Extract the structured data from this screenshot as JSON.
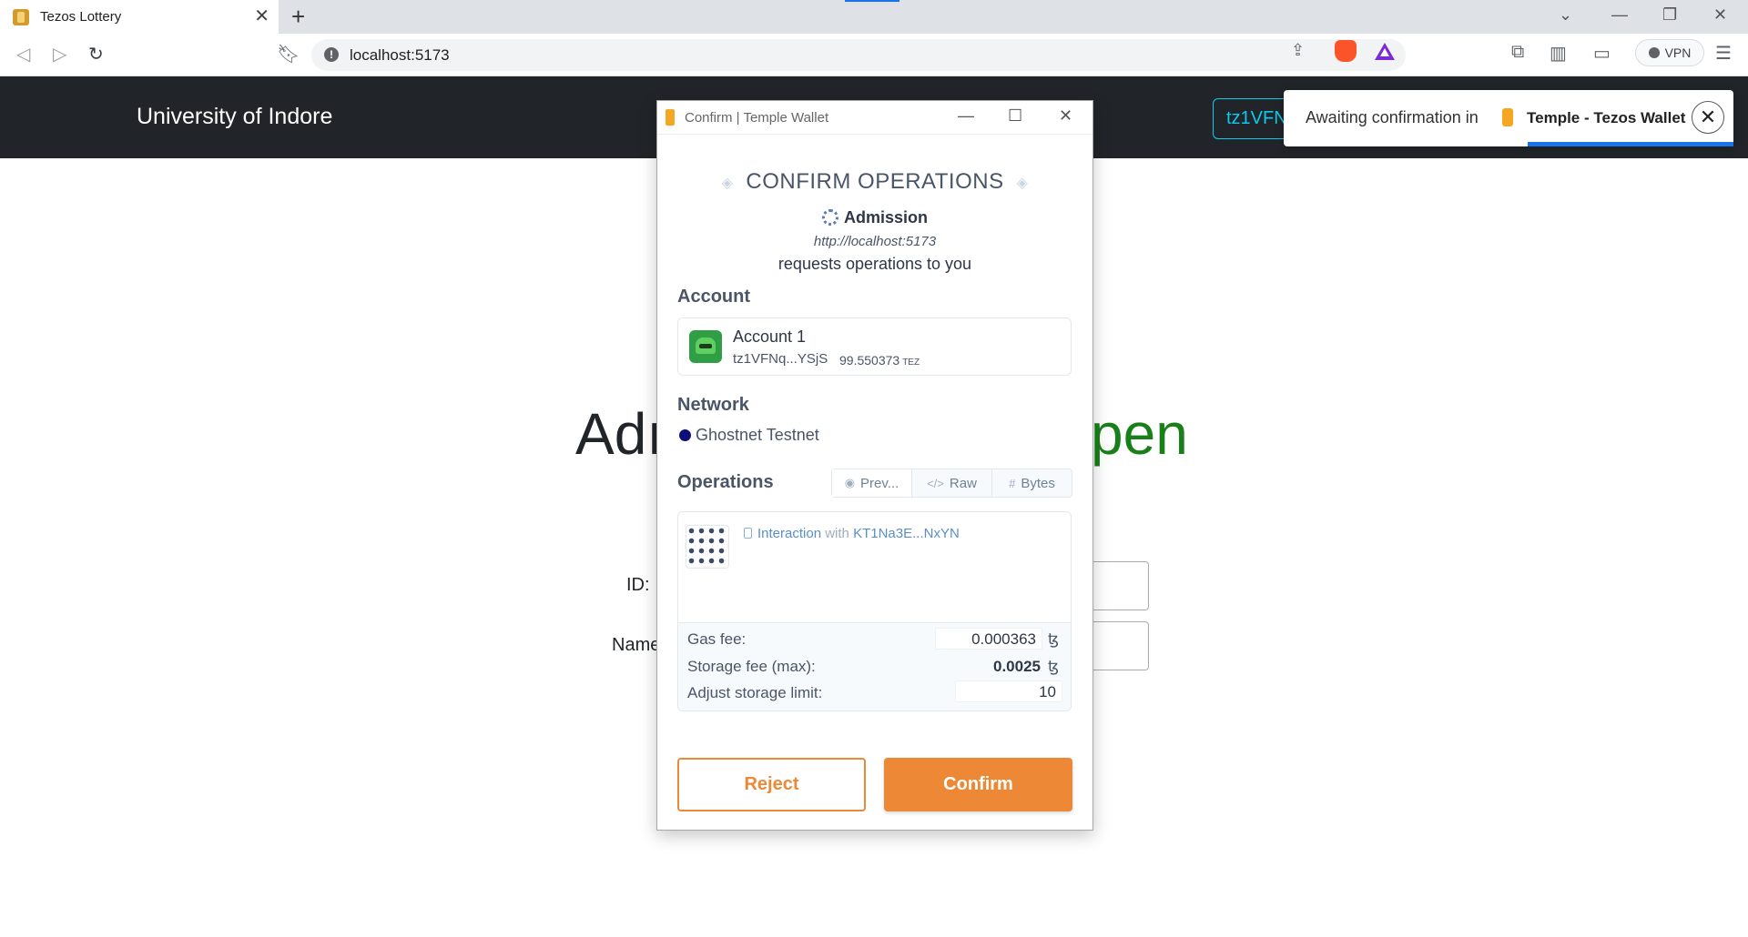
{
  "browser": {
    "tab_title": "Tezos Lottery",
    "url": "localhost:5173",
    "vpn_label": "VPN"
  },
  "page": {
    "brand": "University of Indore",
    "wallet_button": "tz1VFNq",
    "heading_left": "Adı",
    "heading_right": "pen",
    "form": {
      "id_label": "ID:",
      "name_label": "Name"
    }
  },
  "toast": {
    "message": "Awaiting confirmation in",
    "wallet_name": "Temple - Tezos Wallet"
  },
  "popup": {
    "window_title": "Confirm | Temple Wallet",
    "heading": "CONFIRM OPERATIONS",
    "app_name": "Admission",
    "app_url": "http://localhost:5173",
    "request_text": "requests operations to you",
    "account_section": "Account",
    "account": {
      "name": "Account 1",
      "address": "tz1VFNq...YSjS",
      "balance": "99.550373",
      "unit": "TEZ"
    },
    "network_section": "Network",
    "network": {
      "name": "Ghostnet Testnet",
      "color": "#0f0f7a"
    },
    "operations_section": "Operations",
    "op_tabs": [
      "Prev...",
      "Raw",
      "Bytes"
    ],
    "operation": {
      "type": "Interaction",
      "with": "with",
      "contract": "KT1Na3E...NxYN"
    },
    "fees": {
      "gas_label": "Gas fee:",
      "gas_value": "0.000363",
      "storage_label": "Storage fee (max):",
      "storage_value": "0.0025",
      "limit_label": "Adjust storage limit:",
      "limit_value": "10",
      "tez_symbol": "ꜩ"
    },
    "reject_label": "Reject",
    "confirm_label": "Confirm",
    "accent_color": "#ed8936"
  }
}
